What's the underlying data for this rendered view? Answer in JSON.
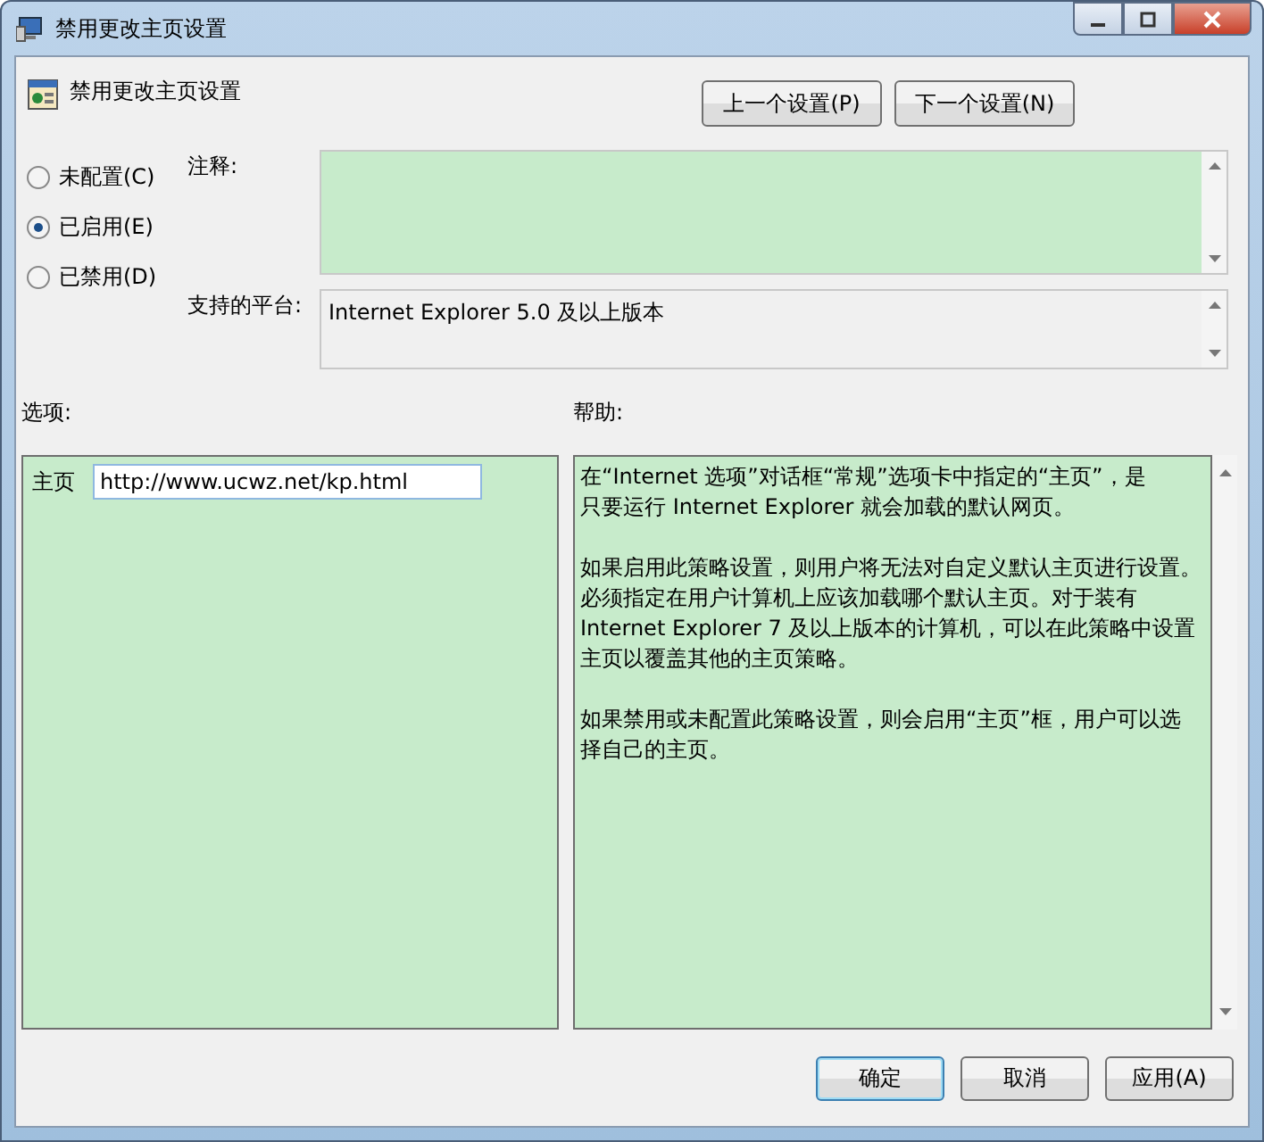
{
  "window": {
    "title": "禁用更改主页设置"
  },
  "header": {
    "title": "禁用更改主页设置"
  },
  "nav_buttons": [
    "上一个设置(P)",
    "下一个设置(N)"
  ],
  "states": [
    {
      "label": "未配置(C)",
      "selected": false
    },
    {
      "label": "已启用(E)",
      "selected": true
    },
    {
      "label": "已禁用(D)",
      "selected": false
    }
  ],
  "comment": {
    "label": "注释:"
  },
  "platform": {
    "label": "支持的平台:",
    "value": "Internet Explorer 5.0 及以上版本"
  },
  "options": {
    "label": "选项:",
    "fields": [
      {
        "label": "主页",
        "value": "http://www.ucwz.net/kp.html"
      }
    ]
  },
  "help": {
    "label": "帮助:",
    "paragraphs": [
      [
        "在“Internet 选项”对话框“常规”选项卡中指定的“主页”，是",
        "只要运行 Internet Explorer 就会加载的默认网页。"
      ],
      [
        "如果启用此策略设置，则用户将无法对自定义默认主页进行设置。",
        "必须指定在用户计算机上应该加载哪个默认主页。对于装有",
        "Internet Explorer 7 及以上版本的计算机，可以在此策略中设置",
        "主页以覆盖其他的主页策略。"
      ],
      [
        "如果禁用或未配置此策略设置，则会启用“主页”框，用户可以选",
        "择自己的主页。"
      ]
    ]
  },
  "buttons": [
    {
      "label": "确定",
      "default": true
    },
    {
      "label": "取消",
      "default": false
    },
    {
      "label": "应用(A)",
      "default": false
    }
  ]
}
